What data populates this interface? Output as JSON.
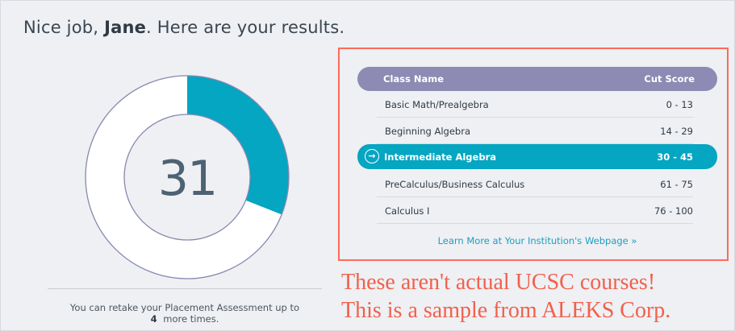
{
  "header": {
    "greeting_prefix": "Nice job, ",
    "user_name": "Jane",
    "greeting_suffix": ". Here are your results."
  },
  "score": {
    "value": "31",
    "fill_fraction": 0.31,
    "fill_color": "#04a6c2"
  },
  "table": {
    "header": {
      "class_name": "Class Name",
      "cut_score": "Cut Score"
    },
    "rows": [
      {
        "name": "Basic Math/Prealgebra",
        "score": "0 - 13"
      },
      {
        "name": "Beginning Algebra",
        "score": "14 - 29"
      },
      {
        "name": "Intermediate Algebra",
        "score": "30 - 45"
      },
      {
        "name": "PreCalculus/Business Calculus",
        "score": "61 - 75"
      },
      {
        "name": "Calculus I",
        "score": "76 - 100"
      }
    ],
    "learn_more": "Learn More at Your Institution's Webpage »",
    "arrow_icon": "→"
  },
  "retake": {
    "line1": "You can retake your Placement Assessment up to",
    "count": "4",
    "line2": "more times."
  },
  "annotation": {
    "line1": "These aren't actual UCSC courses!",
    "line2": "This is a sample from ALEKS Corp.",
    "color": "#f2604c"
  }
}
